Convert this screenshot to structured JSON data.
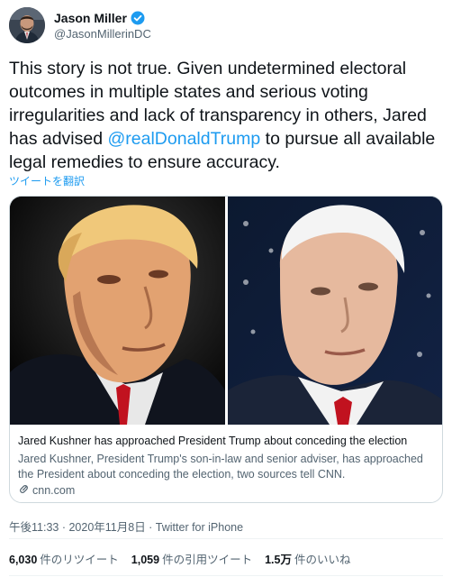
{
  "author": {
    "name": "Jason Miller",
    "handle": "@JasonMillerinDC"
  },
  "tweet": {
    "text_before": "This story is not true. Given undetermined electoral outcomes in multiple states and serious voting irregularities and lack of transparency in others, Jared has advised ",
    "mention": "@realDonaldTrump",
    "text_after": " to pursue all available legal remedies to ensure accuracy.",
    "translate_label": "ツイートを翻訳"
  },
  "card": {
    "headline": "Jared Kushner has approached President Trump about conceding the election",
    "description": "Jared Kushner, President Trump's son-in-law and senior adviser, has approached the President about conceding the election, two sources tell CNN.",
    "domain": "cnn.com"
  },
  "meta": {
    "timestamp": "午後11:33 · 2020年11月8日 · Twitter for iPhone"
  },
  "stats": {
    "retweets_count": "6,030",
    "retweets_label": "件のリツイート",
    "quotes_count": "1,059",
    "quotes_label": "件の引用ツイート",
    "likes_count": "1.5万",
    "likes_label": "件のいいね"
  },
  "colors": {
    "accent": "#1d9bf0",
    "text": "#0f1419",
    "secondary": "#536471",
    "border": "#cfd9de"
  }
}
